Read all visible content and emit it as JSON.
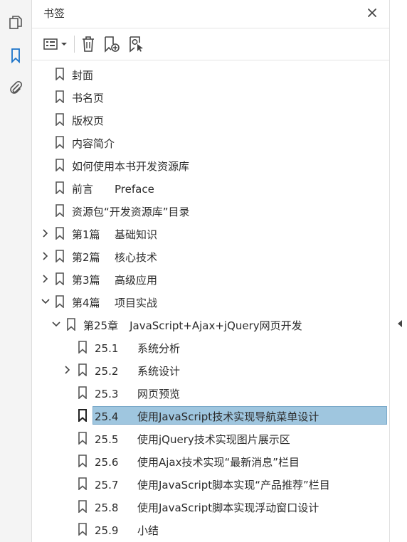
{
  "panel": {
    "title": "书签",
    "close_icon": "close-icon"
  },
  "rail": {
    "tools": [
      "pages-icon",
      "bookmark-icon",
      "attachment-icon"
    ]
  },
  "toolbar": {
    "icons": [
      "options-menu-icon",
      "delete-bookmark-icon",
      "new-bookmark-icon",
      "bookmark-from-structure-icon"
    ]
  },
  "bookmarks": [
    {
      "label": "封面",
      "level": 0,
      "expander": "none"
    },
    {
      "label": "书名页",
      "level": 0,
      "expander": "none"
    },
    {
      "label": "版权页",
      "level": 0,
      "expander": "none"
    },
    {
      "label": "内容简介",
      "level": 0,
      "expander": "none"
    },
    {
      "label": "如何使用本书开发资源库",
      "level": 0,
      "expander": "none"
    },
    {
      "num": "前言",
      "text": "Preface",
      "level": 0,
      "expander": "none"
    },
    {
      "label": "资源包“开发资源库”目录",
      "level": 0,
      "expander": "none"
    },
    {
      "num": "第1篇",
      "text": "基础知识",
      "level": 0,
      "expander": "collapsed"
    },
    {
      "num": "第2篇",
      "text": "核心技术",
      "level": 0,
      "expander": "collapsed"
    },
    {
      "num": "第3篇",
      "text": "高级应用",
      "level": 0,
      "expander": "collapsed"
    },
    {
      "num": "第4篇",
      "text": "项目实战",
      "level": 0,
      "expander": "expanded"
    },
    {
      "num": "第25章",
      "text": "JavaScript+Ajax+jQuery网页开发",
      "level": 1,
      "expander": "expanded"
    },
    {
      "num": "25.1",
      "text": "系统分析",
      "level": 2,
      "expander": "none"
    },
    {
      "num": "25.2",
      "text": "系统设计",
      "level": 2,
      "expander": "collapsed"
    },
    {
      "num": "25.3",
      "text": "网页预览",
      "level": 2,
      "expander": "none"
    },
    {
      "num": "25.4",
      "text": "使用JavaScript技术实现导航菜单设计",
      "level": 2,
      "expander": "none",
      "selected": true
    },
    {
      "num": "25.5",
      "text": "使用jQuery技术实现图片展示区",
      "level": 2,
      "expander": "none"
    },
    {
      "num": "25.6",
      "text": "使用Ajax技术实现“最新消息”栏目",
      "level": 2,
      "expander": "none"
    },
    {
      "num": "25.7",
      "text": "使用JavaScript脚本实现“产品推荐”栏目",
      "level": 2,
      "expander": "none"
    },
    {
      "num": "25.8",
      "text": "使用JavaScript脚本实现浮动窗口设计",
      "level": 2,
      "expander": "none"
    },
    {
      "num": "25.9",
      "text": "小结",
      "level": 2,
      "expander": "none"
    }
  ],
  "colors": {
    "accent": "#1a73c9",
    "selection": "#9fc6df",
    "icon": "#4a4a4a"
  }
}
